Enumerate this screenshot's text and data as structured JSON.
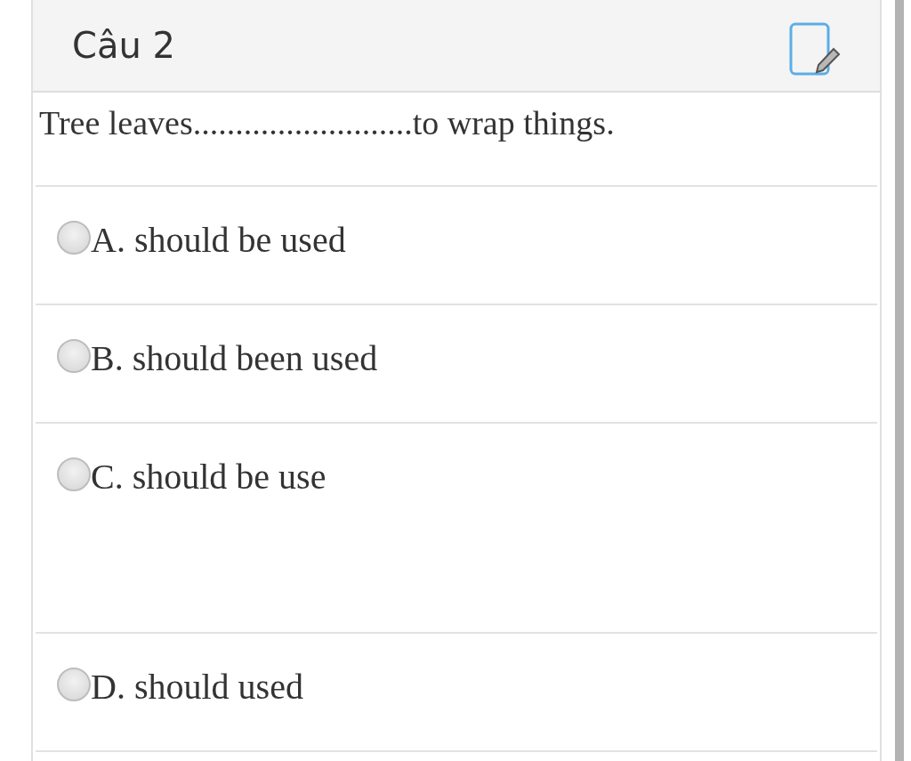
{
  "question": {
    "title": "Câu 2",
    "text": "Tree leaves..........................to wrap things."
  },
  "options": [
    {
      "label": "A. should be used",
      "selected": false
    },
    {
      "label": "B. should been used",
      "selected": false
    },
    {
      "label": "C. should be use",
      "selected": false
    },
    {
      "label": "D. should used",
      "selected": false
    }
  ]
}
